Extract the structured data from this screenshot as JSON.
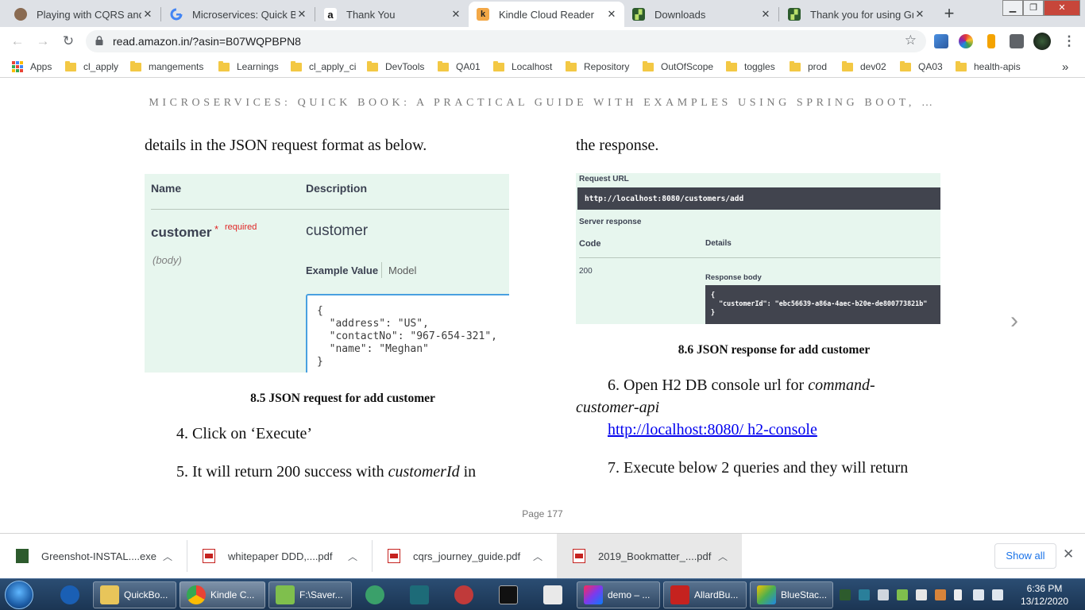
{
  "browser": {
    "tabs": [
      {
        "title": "Playing with CQRS and E",
        "favicon": "avatar-icon",
        "active": false
      },
      {
        "title": "Microservices: Quick Boo",
        "favicon": "google-icon",
        "active": false
      },
      {
        "title": "Thank You",
        "favicon": "amazon-icon",
        "active": false
      },
      {
        "title": "Kindle Cloud Reader",
        "favicon": "kindle-icon",
        "active": true
      },
      {
        "title": "Downloads",
        "favicon": "greenshot-icon",
        "active": false
      },
      {
        "title": "Thank you for using Gree",
        "favicon": "greenshot-icon",
        "active": false
      }
    ],
    "new_tab_label": "+",
    "address": "read.amazon.in/?asin=B07WQPBPN8",
    "bookmarks": [
      "Apps",
      "cl_apply",
      "mangements",
      "Learnings",
      "cl_apply_ci",
      "DevTools",
      "QA01",
      "Localhost",
      "Repository",
      "OutOfScope",
      "toggles",
      "prod",
      "dev02",
      "QA03",
      "health-apis"
    ],
    "more_bookmarks_label": "»"
  },
  "reader": {
    "book_title": "MICROSERVICES: QUICK BOOK: A PRACTICAL GUIDE WITH EXAMPLES USING SPRING BOOT, …",
    "left": {
      "intro": "details in the JSON request format as below.",
      "figure": {
        "col_name": "Name",
        "col_description": "Description",
        "param_name": "customer",
        "required_star": "*",
        "required_label": "required",
        "param_in": "(body)",
        "param_desc": "customer",
        "example_value": "Example Value",
        "model": "Model",
        "json_lines": [
          "{",
          "  \"address\": \"US\",",
          "  \"contactNo\": \"967-654-321\",",
          "  \"name\": \"Meghan\"",
          "}"
        ]
      },
      "caption": "8.5 JSON request for add customer",
      "step4": "4. Click on ‘Execute’",
      "step5_prefix": "5. It will return 200 success with ",
      "step5_italic": "customerId",
      "step5_suffix": " in"
    },
    "right": {
      "intro": "the response.",
      "figure": {
        "request_url_label": "Request URL",
        "request_url": "http://localhost:8080/customers/add",
        "server_response_label": "Server response",
        "code_header": "Code",
        "details_header": "Details",
        "code": "200",
        "response_body_label": "Response body",
        "response_lines": [
          "{",
          "  \"customerId\": \"ebc56639-a86a-4aec-b20e-de800773821b\"",
          "}"
        ]
      },
      "caption": "8.6 JSON response for add customer",
      "step6_prefix": "6. Open H2 DB console url for ",
      "step6_italic_1": "command-",
      "step6_italic_2": "customer-api",
      "step6_link": "http://localhost:8080/ h2-console",
      "step7": "7. Execute below 2 queries and they will return"
    },
    "next_page_label": "›",
    "page_number": "Page 177"
  },
  "downloads": {
    "items": [
      {
        "name": "Greenshot-INSTAL....exe",
        "type": "exe"
      },
      {
        "name": "whitepaper DDD,....pdf",
        "type": "pdf"
      },
      {
        "name": "cqrs_journey_guide.pdf",
        "type": "pdf"
      },
      {
        "name": "2019_Bookmatter_....pdf",
        "type": "pdf"
      }
    ],
    "show_all": "Show all",
    "close": "✕"
  },
  "taskbar": {
    "apps": [
      {
        "label": "",
        "icon": "app-icon"
      },
      {
        "label": "QuickBo...",
        "icon": "folder-icon"
      },
      {
        "label": "Kindle C...",
        "icon": "chrome-icon"
      },
      {
        "label": "F:\\Saver...",
        "icon": "notepad-icon"
      },
      {
        "label": "",
        "icon": "clock-app-icon"
      },
      {
        "label": "",
        "icon": "editor-icon"
      },
      {
        "label": "",
        "icon": "snipping-icon"
      },
      {
        "label": "",
        "icon": "cmd-icon"
      },
      {
        "label": "",
        "icon": "calculator-icon"
      },
      {
        "label": "demo – ...",
        "icon": "intellij-icon"
      },
      {
        "label": "AllardBu...",
        "icon": "pdf-reader-icon"
      },
      {
        "label": "BlueStac...",
        "icon": "bluestacks-icon"
      }
    ],
    "time": "6:36 PM",
    "date": "13/12/2020"
  }
}
